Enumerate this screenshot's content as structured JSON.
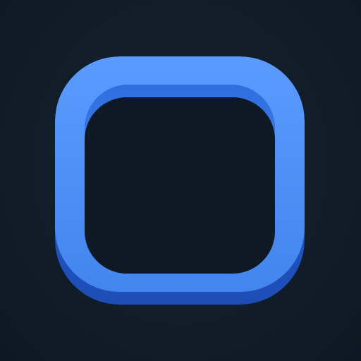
{
  "icon": {
    "semantic_name": "rounded-square-frame-icon",
    "colors": {
      "background": "#111d29",
      "frame_face": "#4285ee",
      "frame_highlight": "#5b9bff",
      "frame_side": "#2a63d6",
      "frame_shadow": "#1d4db5",
      "inner_hole": "#0e1925"
    }
  }
}
